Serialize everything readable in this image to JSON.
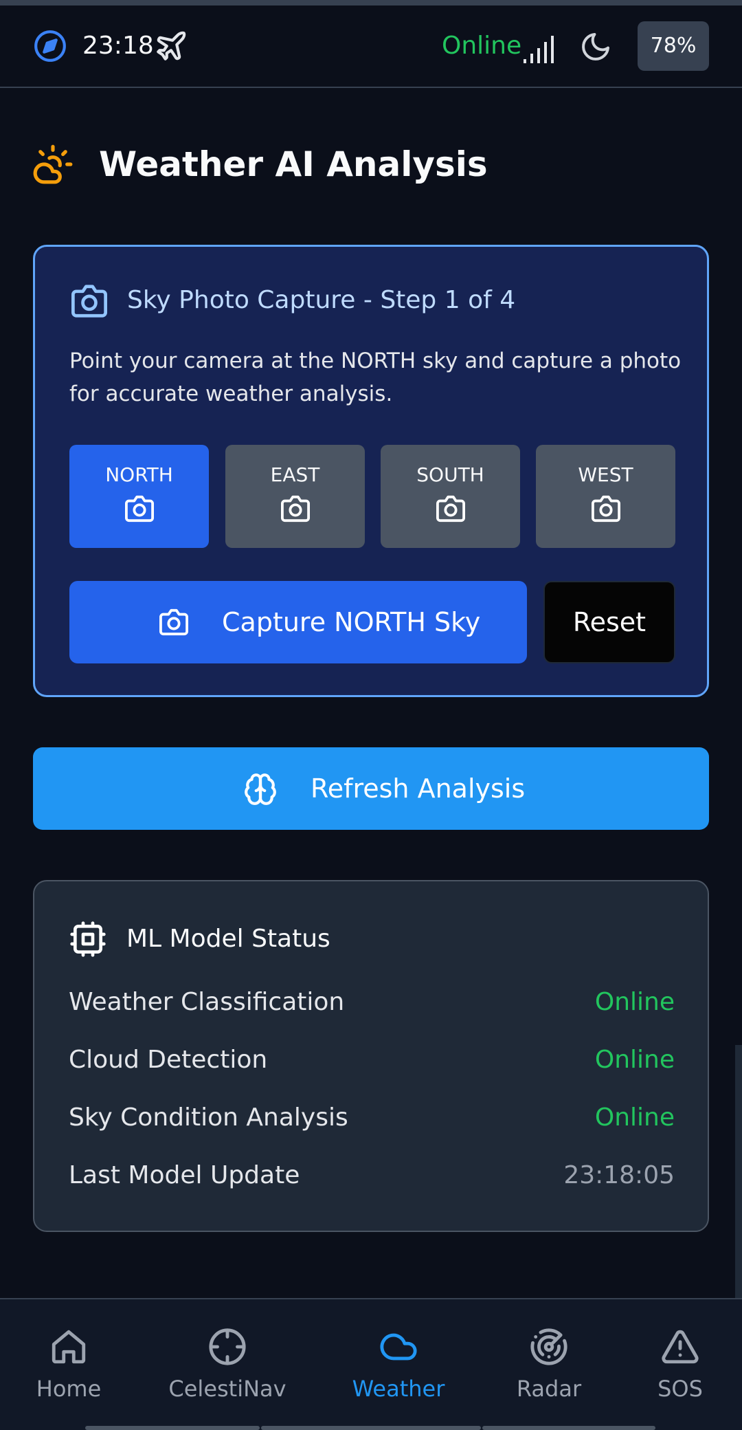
{
  "status_bar": {
    "time": "23:18",
    "connection": "Online",
    "battery": "78%",
    "icons": [
      "compass-icon",
      "plane-icon",
      "signal-icon",
      "moon-icon"
    ]
  },
  "header": {
    "title": "Weather AI Analysis",
    "icon": "cloud-sun-icon"
  },
  "capture": {
    "title": "Sky Photo Capture - Step 1 of 4",
    "description": "Point your camera at the NORTH sky and capture a photo for accurate weather analysis.",
    "directions": [
      {
        "label": "NORTH",
        "active": true
      },
      {
        "label": "EAST",
        "active": false
      },
      {
        "label": "SOUTH",
        "active": false
      },
      {
        "label": "WEST",
        "active": false
      }
    ],
    "capture_label": "Capture NORTH Sky",
    "reset_label": "Reset"
  },
  "refresh": {
    "label": "Refresh Analysis",
    "icon": "brain-icon"
  },
  "ml_status": {
    "title": "ML Model Status",
    "rows": [
      {
        "name": "Weather Classification",
        "value": "Online"
      },
      {
        "name": "Cloud Detection",
        "value": "Online"
      },
      {
        "name": "Sky Condition Analysis",
        "value": "Online"
      },
      {
        "name": "Last Model Update",
        "value": "23:18:05"
      }
    ]
  },
  "nav": {
    "items": [
      {
        "label": "Home",
        "icon": "home-icon"
      },
      {
        "label": "CelestiNav",
        "icon": "crosshair-icon"
      },
      {
        "label": "Weather",
        "icon": "cloud-icon",
        "active": true
      },
      {
        "label": "Radar",
        "icon": "radar-icon"
      },
      {
        "label": "SOS",
        "icon": "alert-triangle-icon"
      }
    ]
  },
  "colors": {
    "background": "#0b0f1a",
    "accent_blue": "#2563eb",
    "refresh_blue": "#2196f3",
    "online_green": "#22c55e",
    "title_icon_orange": "#f59e0b"
  }
}
